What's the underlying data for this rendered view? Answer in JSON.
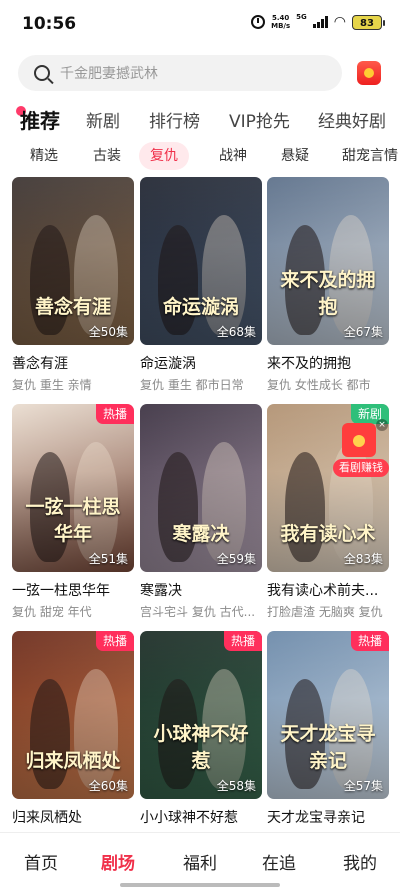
{
  "status_bar": {
    "time": "10:56",
    "net_speed_value": "5.40",
    "net_speed_unit": "MB/s",
    "signal_label": "5G",
    "battery": "83",
    "icons": [
      "alarm-icon",
      "signal-icon",
      "wifi-icon",
      "battery-icon"
    ]
  },
  "search": {
    "placeholder": "千金肥妻撼武林"
  },
  "main_tabs": [
    {
      "label": "推荐",
      "active": true
    },
    {
      "label": "新剧",
      "active": false
    },
    {
      "label": "排行榜",
      "active": false
    },
    {
      "label": "VIP抢先",
      "active": false
    },
    {
      "label": "经典好剧",
      "active": false
    }
  ],
  "genre_tabs": [
    {
      "label": "精选",
      "active": false
    },
    {
      "label": "古装",
      "active": false
    },
    {
      "label": "复仇",
      "active": true
    },
    {
      "label": "战神",
      "active": false
    },
    {
      "label": "悬疑",
      "active": false
    },
    {
      "label": "甜宠言情",
      "active": false
    }
  ],
  "dramas": [
    {
      "title": "善念有涯",
      "tags": "复仇 重生 亲情",
      "episodes": "全50集",
      "badge": "",
      "art": "善念有涯",
      "colors": [
        "#3a3230",
        "#8a6a4a"
      ]
    },
    {
      "title": "命运漩涡",
      "tags": "复仇 重生 都市日常",
      "episodes": "全68集",
      "badge": "",
      "art": "命运漩涡",
      "colors": [
        "#1f2430",
        "#4a5a70"
      ]
    },
    {
      "title": "来不及的拥抱",
      "tags": "复仇 女性成长 都市",
      "episodes": "全67集",
      "badge": "",
      "art": "来不及的拥抱",
      "colors": [
        "#5a6e88",
        "#c9d3de"
      ]
    },
    {
      "title": "一弦一柱思华年",
      "tags": "复仇 甜宠 年代",
      "episodes": "全51集",
      "badge": "热播",
      "art": "一弦一柱思华年",
      "colors": [
        "#e9dccf",
        "#7a4a3a"
      ]
    },
    {
      "title": "寒露决",
      "tags": "宫斗宅斗 复仇 古代...",
      "episodes": "全59集",
      "badge": "",
      "art": "寒露决",
      "colors": [
        "#3a3040",
        "#b0a0b0"
      ]
    },
    {
      "title": "我有读心术前夫...",
      "tags": "打脸虐渣 无脑爽 复仇",
      "episodes": "全83集",
      "badge": "新剧",
      "art": "我有读心术",
      "colors": [
        "#b09070",
        "#e8dccc"
      ]
    },
    {
      "title": "归来凤栖处",
      "tags": "",
      "episodes": "全60集",
      "badge": "热播",
      "art": "归来凤栖处",
      "colors": [
        "#6a2a1a",
        "#d08050"
      ]
    },
    {
      "title": "小小球神不好惹",
      "tags": "",
      "episodes": "全58集",
      "badge": "热播",
      "art": "小球神不好惹",
      "colors": [
        "#1a2a24",
        "#3a6a50"
      ]
    },
    {
      "title": "天才龙宝寻亲记",
      "tags": "",
      "episodes": "全57集",
      "badge": "热播",
      "art": "天才龙宝寻亲记",
      "colors": [
        "#6a88a8",
        "#d0dce8"
      ]
    }
  ],
  "reward": {
    "label": "看剧赚钱",
    "close": "×"
  },
  "bottom_nav": [
    {
      "label": "首页",
      "active": false
    },
    {
      "label": "剧场",
      "active": true
    },
    {
      "label": "福利",
      "active": false
    },
    {
      "label": "在追",
      "active": false
    },
    {
      "label": "我的",
      "active": false
    }
  ]
}
